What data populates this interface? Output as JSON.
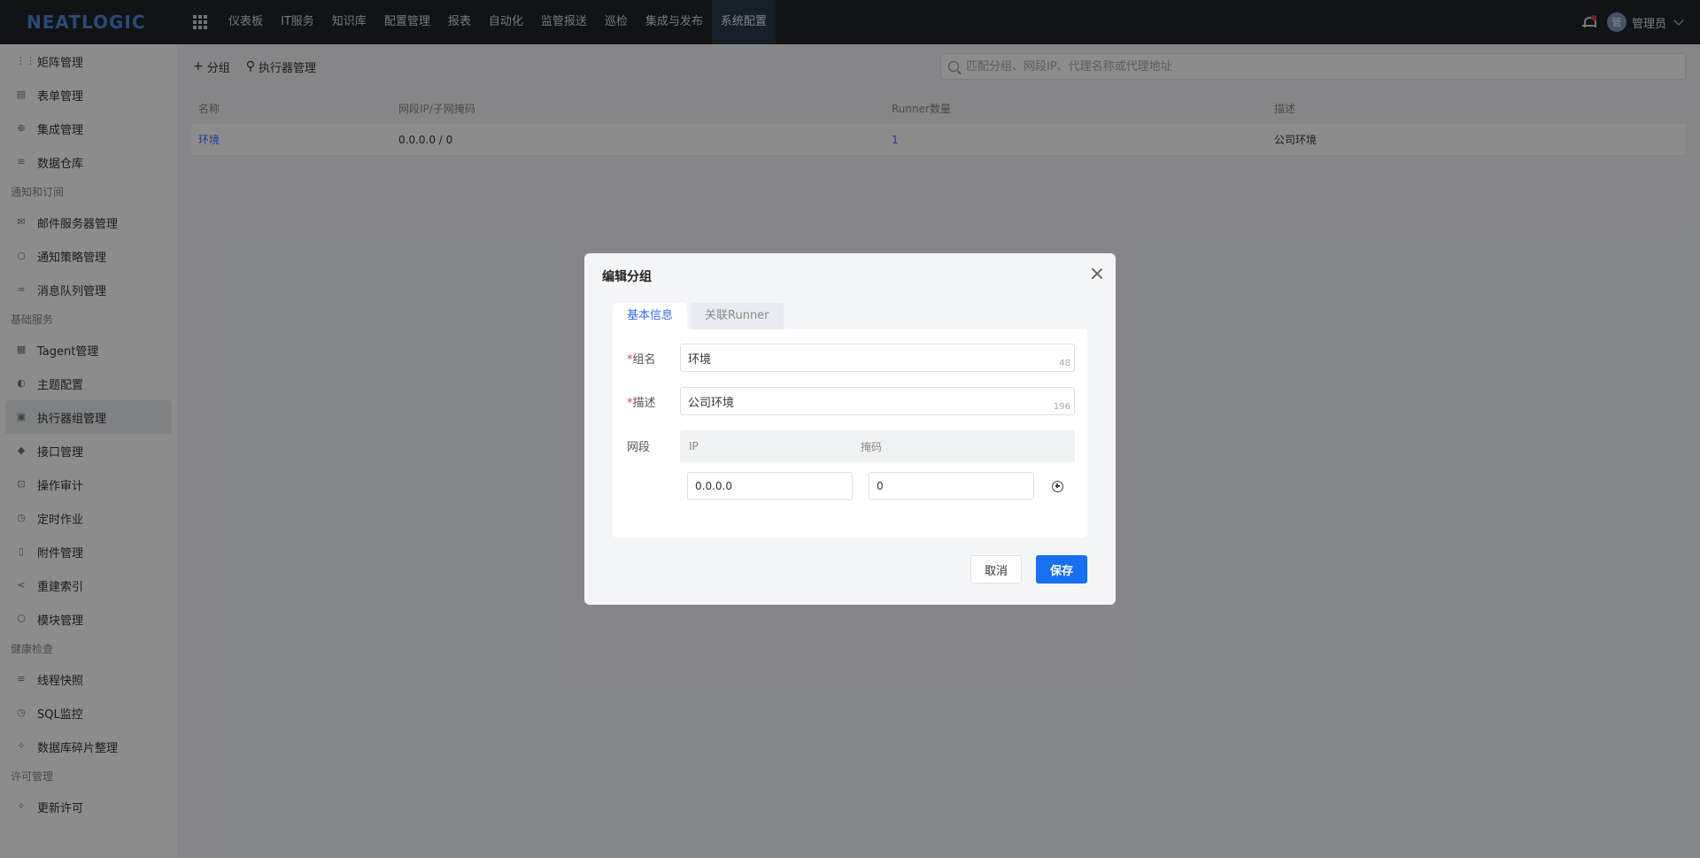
{
  "brand": {
    "logo": "NEATLOGIC"
  },
  "topnav": {
    "items": [
      "仪表板",
      "IT服务",
      "知识库",
      "配置管理",
      "报表",
      "自动化",
      "监管报送",
      "巡检",
      "集成与发布",
      "系统配置"
    ],
    "active": "系统配置"
  },
  "user": {
    "avatar_text": "管",
    "name": "管理员"
  },
  "sidebar": {
    "items_top": [
      "矩阵管理",
      "表单管理",
      "集成管理",
      "数据仓库"
    ],
    "group_notify": {
      "title": "通知和订阅",
      "items": [
        "邮件服务器管理",
        "通知策略管理",
        "消息队列管理"
      ]
    },
    "group_base": {
      "title": "基础服务",
      "items": [
        "Tagent管理",
        "主题配置",
        "执行器组管理",
        "接口管理",
        "操作审计",
        "定时作业",
        "附件管理",
        "重建索引",
        "模块管理"
      ]
    },
    "group_health": {
      "title": "健康检查",
      "items": [
        "线程快照",
        "SQL监控",
        "数据库碎片整理"
      ]
    },
    "group_license": {
      "title": "许可管理",
      "items": [
        "更新许可"
      ]
    },
    "active": "执行器组管理"
  },
  "toolbar": {
    "add_group": "分组",
    "executor_manage": "执行器管理"
  },
  "search": {
    "placeholder": "匹配分组、网段IP、代理名称或代理地址",
    "value": ""
  },
  "table": {
    "columns": [
      "名称",
      "网段IP/子网掩码",
      "Runner数量",
      "描述"
    ],
    "rows": [
      {
        "name": "环境",
        "network": "0.0.0.0 / 0",
        "runner_count": "1",
        "description": "公司环境"
      }
    ]
  },
  "modal": {
    "title": "编辑分组",
    "tabs": [
      "基本信息",
      "关联Runner"
    ],
    "active_tab": "基本信息",
    "form": {
      "required_mark": "*",
      "group_name_label": "组名",
      "group_name_value": "环境",
      "group_name_counter": "48",
      "desc_label": "描述",
      "desc_value": "公司环境",
      "desc_counter": "196",
      "segment_label": "网段",
      "segment_columns": [
        "IP",
        "掩码"
      ],
      "segment_rows": [
        {
          "ip": "0.0.0.0",
          "mask": "0"
        }
      ]
    },
    "cancel_label": "取消",
    "save_label": "保存"
  },
  "colors": {
    "primary": "#1670f0",
    "link": "#336eff",
    "topbar": "#1f2329"
  }
}
